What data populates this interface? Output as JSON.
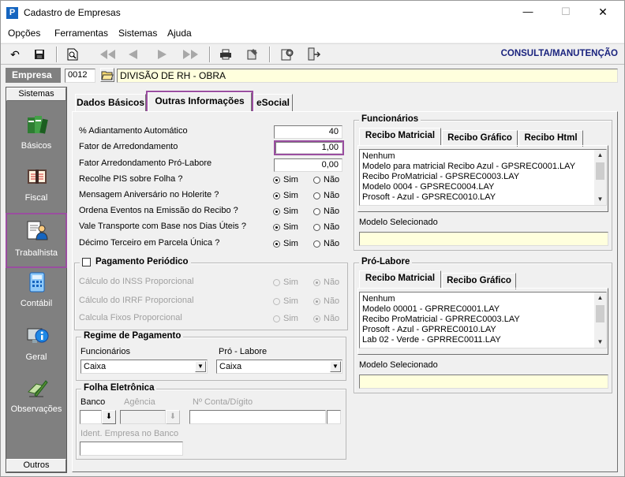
{
  "window": {
    "title": "Cadastro de Empresas",
    "app_icon_letter": "P",
    "controls": {
      "minimize": "—",
      "maximize": "☐",
      "close": "✕"
    }
  },
  "menu": [
    "Opções",
    "Ferramentas",
    "Sistemas",
    "Ajuda"
  ],
  "toolbar": {
    "mode": "CONSULTA/MANUTENÇÃO"
  },
  "empresa": {
    "label": "Empresa",
    "code": "0012",
    "name": "DIVISÃO DE RH - OBRA"
  },
  "sidebar": {
    "header": "Sistemas",
    "footer": "Outros",
    "items": [
      {
        "label": "Básicos",
        "icon": "books-icon"
      },
      {
        "label": "Fiscal",
        "icon": "ledger-icon"
      },
      {
        "label": "Trabalhista",
        "icon": "worker-icon",
        "selected": true
      },
      {
        "label": "Contábil",
        "icon": "calculator-icon"
      },
      {
        "label": "Geral",
        "icon": "info-icon"
      },
      {
        "label": "Observações",
        "icon": "pencil-icon"
      }
    ]
  },
  "tabs": [
    "Dados Básicos",
    "Outras Informações",
    "eSocial"
  ],
  "active_tab": "Outras Informações",
  "form": {
    "adiantamento_label": "% Adiantamento Automático",
    "adiantamento_value": "40",
    "fator_label": "Fator de Arredondamento",
    "fator_value": "1,00",
    "fator_pl_label": "Fator Arredondamento Pró-Labore",
    "fator_pl_value": "0,00",
    "questions": [
      {
        "label": "Recolhe PIS sobre Folha ?",
        "value": "Sim"
      },
      {
        "label": "Mensagem Aniversário no Holerite ?",
        "value": "Sim"
      },
      {
        "label": "Ordena Eventos na Emissão do Recibo ?",
        "value": "Sim"
      },
      {
        "label": "Vale Transporte com Base nos Dias Úteis ?",
        "value": "Sim"
      },
      {
        "label": "Décimo Terceiro em Parcela Única ?",
        "value": "Sim"
      }
    ],
    "sim": "Sim",
    "nao": "Não"
  },
  "pagamento_periodico": {
    "title": "Pagamento Periódico",
    "checked": false,
    "rows": [
      "Cálculo do INSS Proporcional",
      "Cálculo do IRRF Proporcional",
      "Calcula Fixos Proporcional"
    ],
    "value": "Não"
  },
  "regime": {
    "title": "Regime de Pagamento",
    "func_label": "Funcionários",
    "func_value": "Caixa",
    "pl_label": "Pró - Labore",
    "pl_value": "Caixa"
  },
  "folha": {
    "title": "Folha Eletrônica",
    "banco_label": "Banco",
    "agencia_label": "Agência",
    "conta_label": "Nº Conta/Dígito",
    "ident_label": "Ident. Empresa no Banco",
    "down_arrow": "⬇"
  },
  "funcionarios": {
    "title": "Funcionários",
    "tabs": [
      "Recibo Matricial",
      "Recibo Gráfico",
      "Recibo Html"
    ],
    "items": [
      "Nenhum",
      "Modelo para matricial Recibo Azul - GPSREC0001.LAY",
      "Recibo ProMatricial - GPSREC0003.LAY",
      "Modelo 0004 - GPSREC0004.LAY",
      "Prosoft - Azul - GPSREC0010.LAY"
    ],
    "selected_label": "Modelo Selecionado",
    "selected_value": ""
  },
  "prolabore": {
    "title": "Pró-Labore",
    "tabs": [
      "Recibo Matricial",
      "Recibo Gráfico"
    ],
    "items": [
      "Nenhum",
      "Modelo 00001 - GPRREC0001.LAY",
      "Recibo ProMatricial - GPRREC0003.LAY",
      "Prosoft - Azul - GPRREC0010.LAY",
      "Lab 02 - Verde - GPRREC0011.LAY"
    ],
    "selected_label": "Modelo Selecionado",
    "selected_value": ""
  },
  "colors": {
    "accent": "#9a4ea0",
    "mode_text": "#1a237e",
    "yellow_field": "#ffffdd",
    "sidebar_bg": "#808080"
  }
}
